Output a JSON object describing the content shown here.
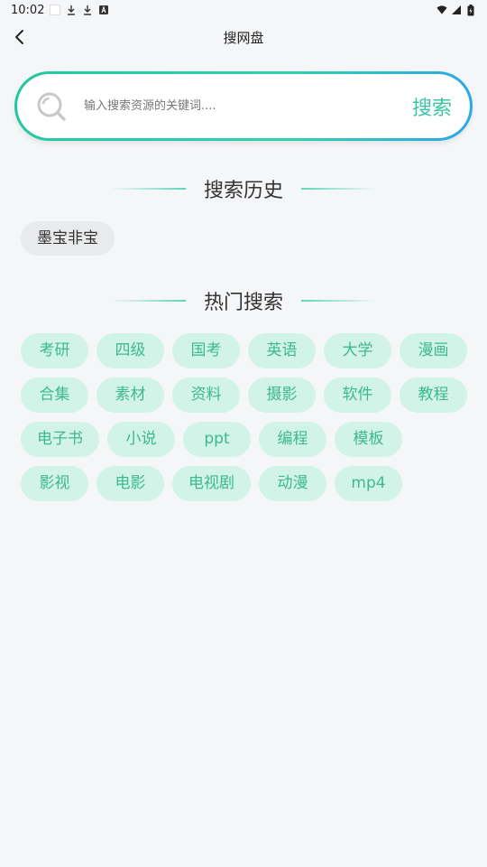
{
  "status_bar": {
    "time": "10:02",
    "icons": [
      "download-icon",
      "download-icon",
      "a-badge-icon",
      "wifi-icon",
      "signal-icon",
      "battery-icon"
    ]
  },
  "header": {
    "title": "搜网盘"
  },
  "search": {
    "placeholder": "输入搜索资源的关键词....",
    "button_label": "搜索"
  },
  "history": {
    "title": "搜索历史",
    "items": [
      "墨宝非宝"
    ]
  },
  "hot": {
    "title": "热门搜索",
    "items": [
      "考研",
      "四级",
      "国考",
      "英语",
      "大学",
      "漫画",
      "合集",
      "素材",
      "资料",
      "摄影",
      "软件",
      "教程",
      "电子书",
      "小说",
      "ppt",
      "编程",
      "模板",
      "影视",
      "电影",
      "电视剧",
      "动漫",
      "mp4"
    ]
  },
  "colors": {
    "accent": "#3cc3a3",
    "chip_bg": "#d2f3e8",
    "chip_text": "#3cb98e",
    "history_chip_bg": "#e9eaec"
  }
}
